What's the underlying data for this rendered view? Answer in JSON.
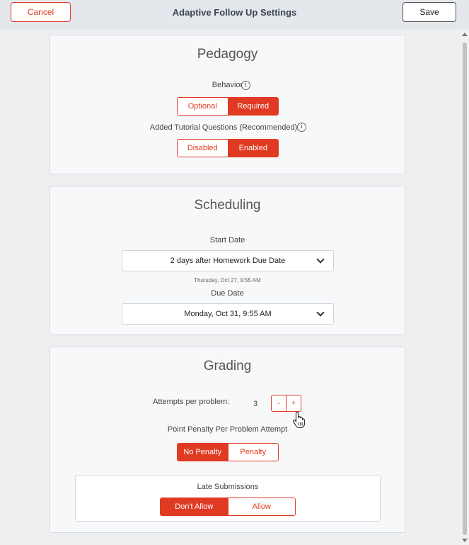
{
  "header": {
    "title": "Adaptive Follow Up Settings",
    "cancel_label": "Cancel",
    "save_label": "Save"
  },
  "pedagogy": {
    "title": "Pedagogy",
    "behavior": {
      "label": "Behavior",
      "options": [
        "Optional",
        "Required"
      ],
      "selected": "Required"
    },
    "tutorial": {
      "label": "Added Tutorial Questions (Recommended)",
      "options": [
        "Disabled",
        "Enabled"
      ],
      "selected": "Enabled"
    },
    "info_icon_glyph": "i"
  },
  "scheduling": {
    "title": "Scheduling",
    "start_date": {
      "label": "Start Date",
      "value": "2 days after Homework Due Date",
      "computed": "Thursday, Oct 27, 9:55 AM"
    },
    "due_date": {
      "label": "Due Date",
      "value": "Monday, Oct 31, 9:55 AM"
    }
  },
  "grading": {
    "title": "Grading",
    "attempts": {
      "label": "Attempts per problem:",
      "value": "3",
      "minus": "-",
      "plus": "+"
    },
    "penalty": {
      "label": "Point Penalty Per Problem Attempt",
      "options": [
        "No Penalty",
        "Penalty"
      ],
      "selected": "No Penalty"
    },
    "late": {
      "label": "Late Submissions",
      "options": [
        "Don't Allow",
        "Allow"
      ],
      "selected": "Don't Allow"
    }
  },
  "colors": {
    "accent": "#e03a22",
    "header_bg": "#e4e7ec",
    "card_bg": "#f7f8fa"
  }
}
